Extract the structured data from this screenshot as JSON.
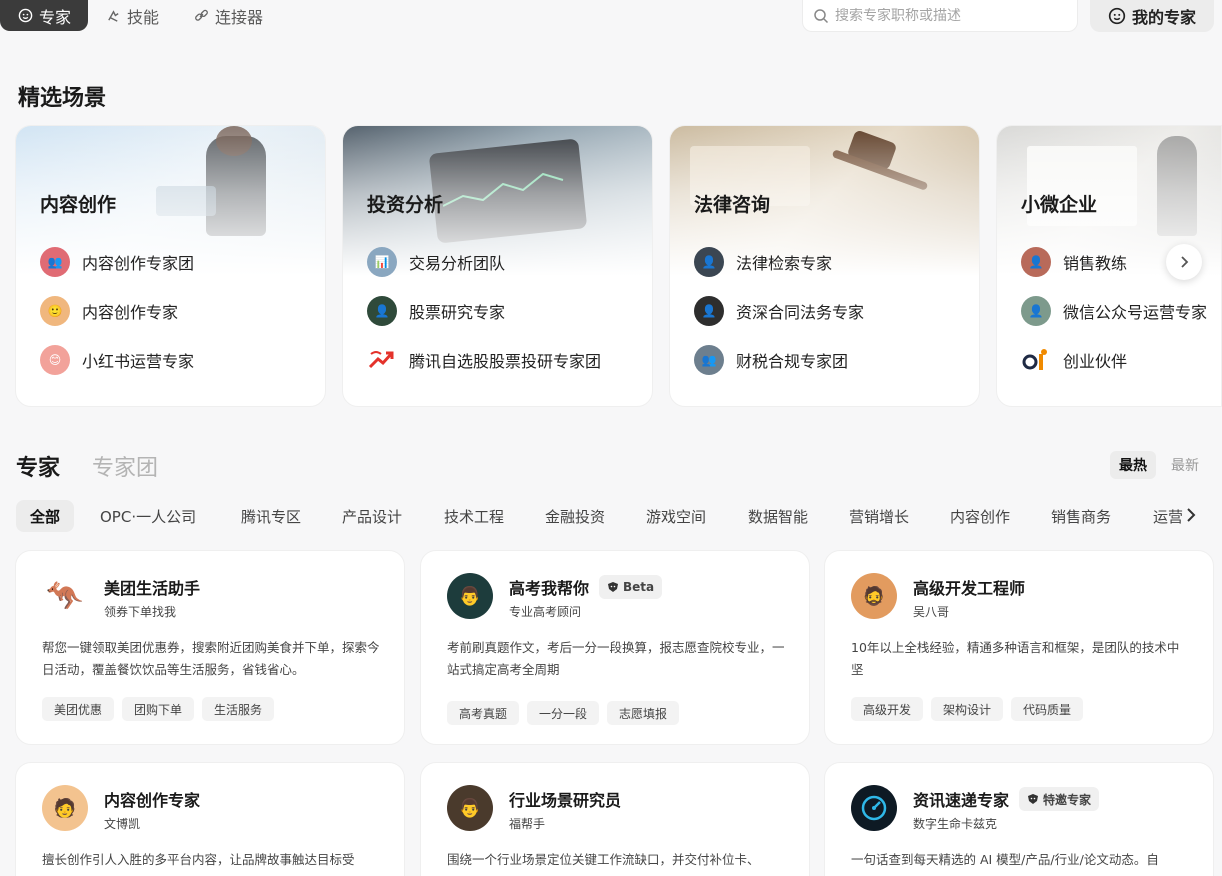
{
  "topbar": {
    "tabs": [
      {
        "label": "专家",
        "icon": "expert-face-icon",
        "active": true
      },
      {
        "label": "技能",
        "icon": "skill-icon",
        "active": false
      },
      {
        "label": "连接器",
        "icon": "link-icon",
        "active": false
      }
    ],
    "search_placeholder": "搜索专家职称或描述",
    "my_experts": "我的专家"
  },
  "featured": {
    "title": "精选场景",
    "scenarios": [
      {
        "title": "内容创作",
        "items": [
          "内容创作专家团",
          "内容创作专家",
          "小红书运营专家"
        ]
      },
      {
        "title": "投资分析",
        "items": [
          "交易分析团队",
          "股票研究专家",
          "腾讯自选股股票投研专家团"
        ]
      },
      {
        "title": "法律咨询",
        "items": [
          "法律检索专家",
          "资深合同法务专家",
          "财税合规专家团"
        ]
      },
      {
        "title": "小微企业",
        "items": [
          "销售教练",
          "微信公众号运营专家",
          "创业伙伴"
        ]
      }
    ]
  },
  "experts_section": {
    "seg_experts": "专家",
    "seg_teams": "专家团",
    "sort_hot": "最热",
    "sort_new": "最新",
    "categories": [
      "全部",
      "OPC·一人公司",
      "腾讯专区",
      "产品设计",
      "技术工程",
      "金融投资",
      "游戏空间",
      "数据智能",
      "营销增长",
      "内容创作",
      "销售商务",
      "运营"
    ]
  },
  "experts": [
    {
      "name": "美团生活助手",
      "sub": "领券下单找我",
      "badge": "",
      "desc": "帮您一键领取美团优惠券，搜索附近团购美食并下单，探索今日活动，覆盖餐饮饮品等生活服务，省钱省心。",
      "tags": [
        "美团优惠",
        "团购下单",
        "生活服务"
      ]
    },
    {
      "name": "高考我帮你",
      "sub": "专业高考顾问",
      "badge": "Beta",
      "desc": "考前刷真题作文，考后一分一段换算，报志愿查院校专业，一站式搞定高考全周期",
      "tags": [
        "高考真题",
        "一分一段",
        "志愿填报"
      ]
    },
    {
      "name": "高级开发工程师",
      "sub": "吴八哥",
      "badge": "",
      "desc": "10年以上全栈经验，精通多种语言和框架，是团队的技术中坚",
      "tags": [
        "高级开发",
        "架构设计",
        "代码质量"
      ]
    },
    {
      "name": "内容创作专家",
      "sub": "文博凯",
      "badge": "",
      "desc": "擅长创作引人入胜的多平台内容，让品牌故事触达目标受",
      "tags": []
    },
    {
      "name": "行业场景研究员",
      "sub": "福帮手",
      "badge": "",
      "desc": "围绕一个行业场景定位关键工作流缺口，并交付补位卡、",
      "tags": []
    },
    {
      "name": "资讯速递专家",
      "sub": "数字生命卡兹克",
      "badge": "特邀专家",
      "desc": "一句话查到每天精选的 AI 模型/产品/行业/论文动态。自",
      "tags": []
    }
  ]
}
